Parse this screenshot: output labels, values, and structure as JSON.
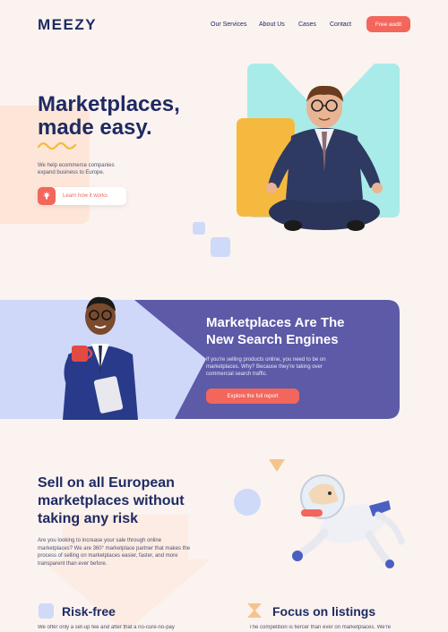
{
  "header": {
    "logo": "MEEZY",
    "nav": [
      "Our Services",
      "About Us",
      "Cases",
      "Contact"
    ],
    "cta": "Free audit"
  },
  "hero": {
    "title_line1": "Marketplaces,",
    "title_line2": "made easy.",
    "description_line1": "We help ecommerce companies",
    "description_line2": "expand business to Europe.",
    "button": "Learn how it works"
  },
  "banner": {
    "title_line1": "Marketplaces Are The",
    "title_line2": "New Search Engines",
    "description_line1": "If you're selling products online, you need to be on",
    "description_line2": "marketplaces. Why? Because they're taking over",
    "description_line3": "commercial search traffic.",
    "button": "Explore the full report"
  },
  "sell": {
    "title_line1": "Sell on all European",
    "title_line2": "marketplaces without",
    "title_line3": "taking any risk",
    "description_line1": "Are you looking to increase your sale through online",
    "description_line2": "marketplaces? We are 360° marketplace partner that makes the",
    "description_line3": "process of selling on marketplaces easier, faster, and more",
    "description_line4": "transparent than ever before."
  },
  "features": [
    {
      "title": "Risk-free",
      "description": "We offer only a set-up fee and after that a no-cure-no-pay"
    },
    {
      "title": "Focus on listings",
      "description": "The competition is fiercer than ever on marketplaces.  We're"
    }
  ],
  "colors": {
    "accent": "#f2665b",
    "navy": "#1f2a63",
    "purple": "#5d5aa8",
    "teal": "#a9ebe8",
    "orange": "#f5b93f",
    "light_blue": "#cfdaf9",
    "background": "#fbf3ef"
  }
}
